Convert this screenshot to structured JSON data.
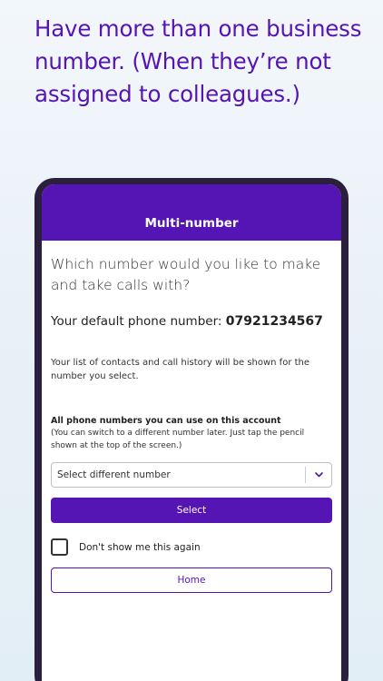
{
  "promo": {
    "headline": "Have more than one business number. (When they’re not assigned to colleagues.)"
  },
  "appbar": {
    "title": "Multi-number"
  },
  "main": {
    "question": "Which number would you like to make and take calls with?",
    "default_label": "Your default phone number:",
    "default_number": "07921234567",
    "info": "Your list of contacts and call history will be shown for the number you select.",
    "list_title": "All phone numbers you can use on this account",
    "list_note": "(You can switch to a different number later. Just tap the pencil shown at the top of the screen.)",
    "dropdown_value": "Select different number",
    "select_label": "Select",
    "checkbox_label": "Don't show me this again",
    "checkbox_checked": false,
    "home_label": "Home"
  },
  "colors": {
    "brand_purple": "#5514b4",
    "device_frame": "#2a1f3d"
  },
  "icons": {
    "dropdown": "chevron-down-icon"
  }
}
